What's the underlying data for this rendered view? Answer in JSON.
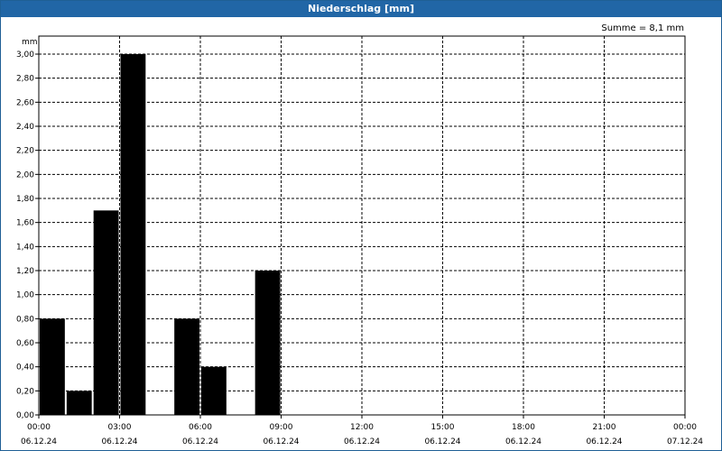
{
  "window": {
    "title": "Niederschlag [mm]"
  },
  "summary": "Summe = 8,1 mm",
  "colors": {
    "titlebar": "#2166a6",
    "bar": "#000000",
    "grid": "#000000"
  },
  "chart_data": {
    "type": "bar",
    "title": "Niederschlag [mm]",
    "ylabel": "mm",
    "ylim": [
      0,
      3.0
    ],
    "y_ticks": [
      "0,00",
      "0,20",
      "0,40",
      "0,60",
      "0,80",
      "1,00",
      "1,20",
      "1,40",
      "1,60",
      "1,80",
      "2,00",
      "2,20",
      "2,40",
      "2,60",
      "2,80",
      "3,00"
    ],
    "x_range_hours": [
      0,
      24
    ],
    "x_ticks": [
      {
        "time": "00:00",
        "date": "06.12.24"
      },
      {
        "time": "03:00",
        "date": "06.12.24"
      },
      {
        "time": "06:00",
        "date": "06.12.24"
      },
      {
        "time": "09:00",
        "date": "06.12.24"
      },
      {
        "time": "12:00",
        "date": "06.12.24"
      },
      {
        "time": "15:00",
        "date": "06.12.24"
      },
      {
        "time": "18:00",
        "date": "06.12.24"
      },
      {
        "time": "21:00",
        "date": "06.12.24"
      },
      {
        "time": "00:00",
        "date": "07.12.24"
      }
    ],
    "bars": [
      {
        "hour": 0,
        "value": 0.8
      },
      {
        "hour": 1,
        "value": 0.2
      },
      {
        "hour": 2,
        "value": 1.7
      },
      {
        "hour": 3,
        "value": 3.0
      },
      {
        "hour": 5,
        "value": 0.8
      },
      {
        "hour": 6,
        "value": 0.4
      },
      {
        "hour": 8,
        "value": 1.2
      }
    ],
    "grid": true
  }
}
